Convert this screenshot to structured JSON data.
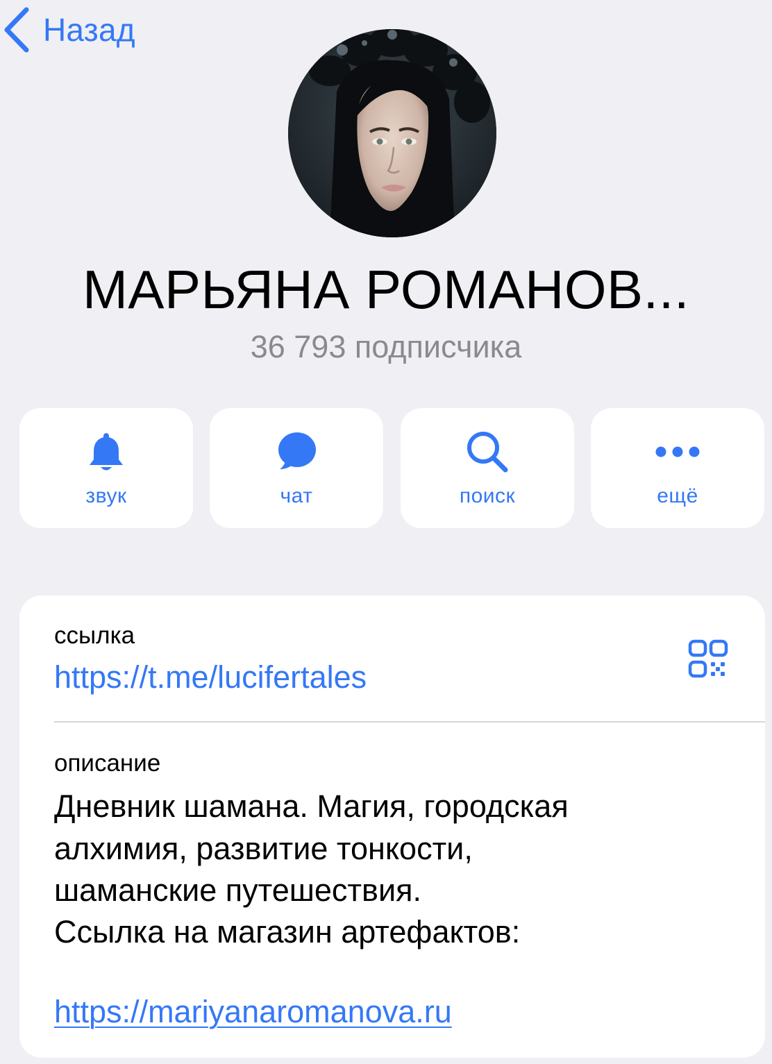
{
  "nav": {
    "back_label": "Назад"
  },
  "channel": {
    "title": "МАРЬЯНА РОМАНОВ...",
    "subscribers": "36 793 подписчика"
  },
  "actions": [
    {
      "label": "звук",
      "icon": "bell-icon"
    },
    {
      "label": "чат",
      "icon": "chat-bubble-icon"
    },
    {
      "label": "поиск",
      "icon": "search-icon"
    },
    {
      "label": "ещё",
      "icon": "more-dots-icon"
    }
  ],
  "info": {
    "link_label": "ссылка",
    "link_value": "https://t.me/lucifertales",
    "description_label": "описание",
    "description_lines": [
      "Дневник шамана. Магия, городская",
      "алхимия, развитие тонкости,",
      "шаманские путешествия.",
      "Ссылка на магазин артефактов:"
    ],
    "description_link": "https://mariyanaromanova.ru"
  },
  "colors": {
    "accent": "#3478f6",
    "background": "#efeff4",
    "card": "#ffffff",
    "secondary_text": "#8a8a8e"
  }
}
